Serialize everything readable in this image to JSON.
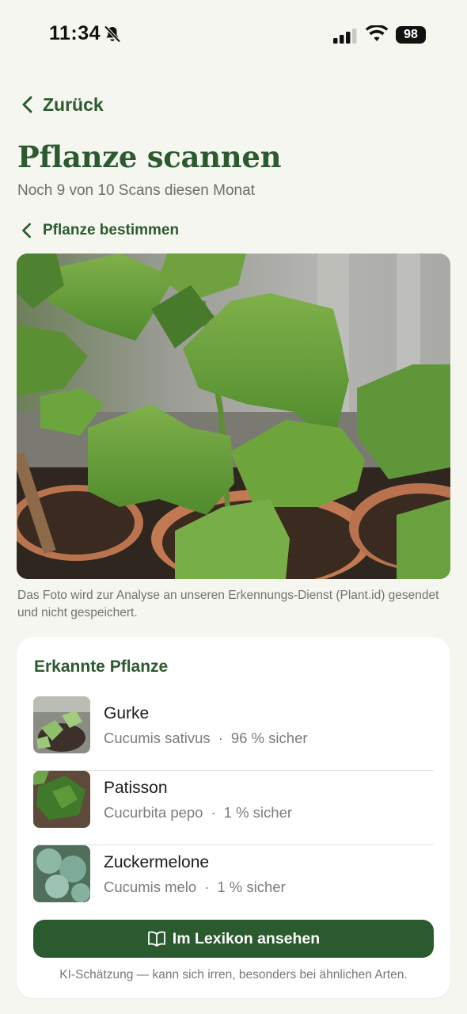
{
  "status_bar": {
    "time": "11:34",
    "battery": "98",
    "icons": [
      "bell-slash-icon",
      "signal-icon",
      "wifi-icon",
      "battery-icon"
    ]
  },
  "nav": {
    "back_label": "Zurück"
  },
  "page": {
    "title": "Pflanze scannen",
    "subtitle": "Noch 9 von 10 Scans diesen Monat",
    "sub_back_label": "Pflanze bestimmen"
  },
  "photo_note": "Das Foto wird zur Analyse an unseren Erkennungs-Dienst (Plant.id) gesendet und nicht gespeichert.",
  "results": {
    "title": "Erkannte Pflanze",
    "items": [
      {
        "name": "Gurke",
        "latin": "Cucumis sativus",
        "sep": "·",
        "confidence": "96 % sicher"
      },
      {
        "name": "Patisson",
        "latin": "Cucurbita pepo",
        "sep": "·",
        "confidence": "1 % sicher"
      },
      {
        "name": "Zuckermelone",
        "latin": "Cucumis melo",
        "sep": "·",
        "confidence": "1 % sicher"
      }
    ],
    "button_label": "Im Lexikon ansehen",
    "disclaimer": "KI-Schätzung — kann sich irren, besonders bei ähnlichen Arten."
  },
  "colors": {
    "accent": "#2c5a2f",
    "background": "#f6f6f1",
    "card": "#ffffff",
    "muted": "#7c7c78"
  }
}
